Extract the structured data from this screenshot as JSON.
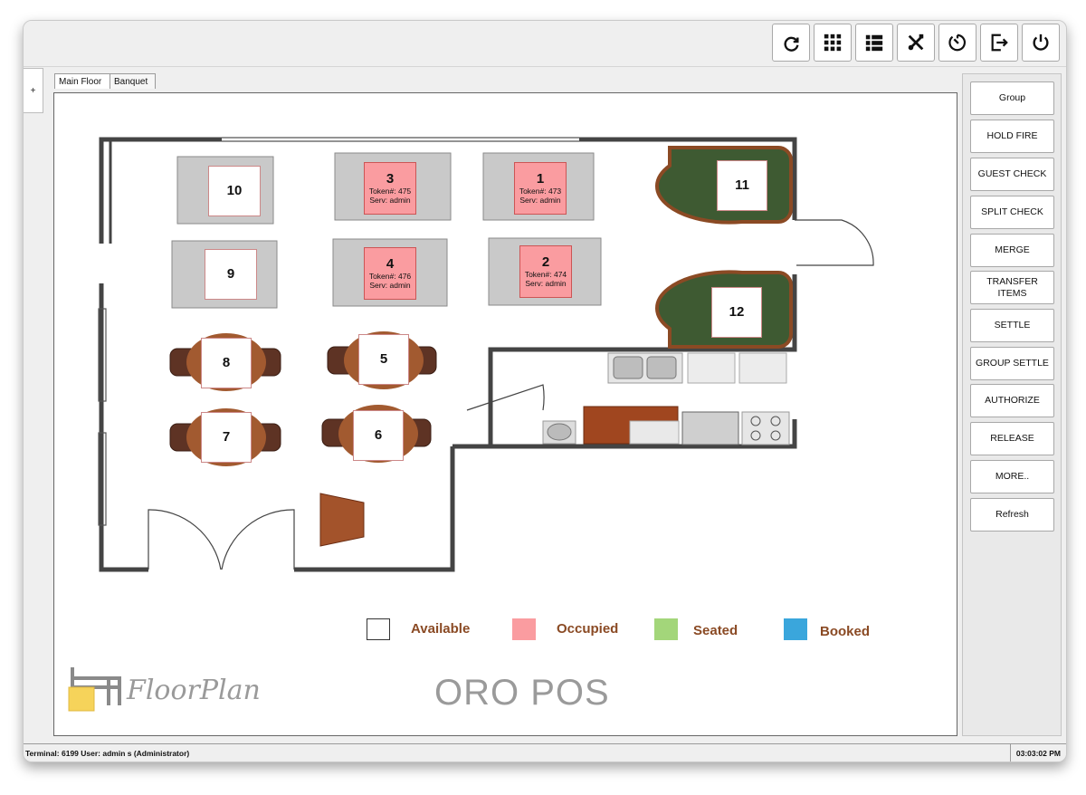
{
  "toolbar": {
    "buttons": [
      {
        "name": "refresh-icon"
      },
      {
        "name": "grid-icon"
      },
      {
        "name": "list-icon"
      },
      {
        "name": "tools-icon"
      },
      {
        "name": "timer-icon"
      },
      {
        "name": "logout-icon"
      },
      {
        "name": "power-icon"
      }
    ]
  },
  "side_tab": {
    "label": "+"
  },
  "tabs": [
    {
      "label": "Main Floor",
      "active": true
    },
    {
      "label": "Banquet",
      "active": false
    }
  ],
  "tables": [
    {
      "number": "10",
      "status": "available"
    },
    {
      "number": "3",
      "status": "occupied",
      "token": "Token#: 475",
      "server": "Serv: admin"
    },
    {
      "number": "1",
      "status": "occupied",
      "token": "Token#: 473",
      "server": "Serv: admin"
    },
    {
      "number": "11",
      "status": "available"
    },
    {
      "number": "9",
      "status": "available"
    },
    {
      "number": "4",
      "status": "occupied",
      "token": "Token#: 476",
      "server": "Serv: admin"
    },
    {
      "number": "2",
      "status": "occupied",
      "token": "Token#: 474",
      "server": "Serv: admin"
    },
    {
      "number": "12",
      "status": "available"
    },
    {
      "number": "8",
      "status": "available"
    },
    {
      "number": "5",
      "status": "available"
    },
    {
      "number": "7",
      "status": "available"
    },
    {
      "number": "6",
      "status": "available"
    }
  ],
  "legend": [
    {
      "label": "Available",
      "color": "#ffffff"
    },
    {
      "label": "Occupied",
      "color": "#fa9ca0"
    },
    {
      "label": "Seated",
      "color": "#a3d67a"
    },
    {
      "label": "Booked",
      "color": "#3aa6dc"
    }
  ],
  "branding": {
    "logo_text": "FloorPlan",
    "app_name": "ORO POS"
  },
  "actions": [
    "Group",
    "HOLD FIRE",
    "GUEST CHECK",
    "SPLIT CHECK",
    "MERGE",
    "TRANSFER ITEMS",
    "SETTLE",
    "GROUP SETTLE",
    "AUTHORIZE",
    "RELEASE",
    "MORE..",
    "Refresh"
  ],
  "status": {
    "left": "Terminal: 6199 User: admin s (Administrator)",
    "time": "03:03:02 PM"
  },
  "colors": {
    "occupied": "#fa9ca0",
    "wall": "#444444",
    "wood": "#8b4a24",
    "booth": "#3e5a32"
  }
}
